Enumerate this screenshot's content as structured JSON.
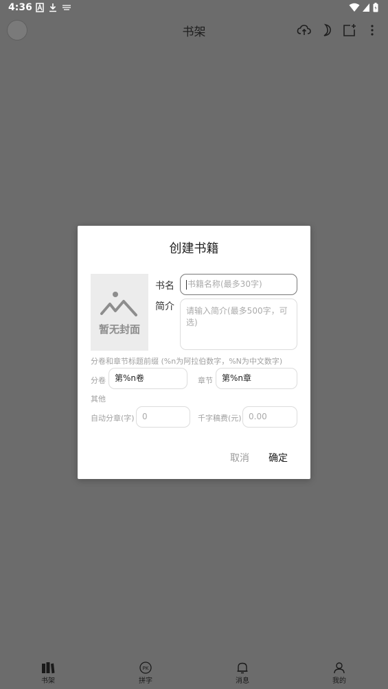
{
  "status_bar": {
    "time": "4:36"
  },
  "app_bar": {
    "title": "书架"
  },
  "dialog": {
    "title": "创建书籍",
    "cover_text": "暂无封面",
    "name_label": "书名",
    "name_placeholder": "书籍名称(最多30字)",
    "intro_label": "简介",
    "intro_placeholder": "请输入简介(最多500字，可选)",
    "prefix_hint": "分卷和章节标题前缀 (%n为阿拉伯数字，%N为中文数字)",
    "volume_label": "分卷",
    "volume_value": "第%n卷",
    "chapter_label": "章节",
    "chapter_value": "第%n章",
    "other_label": "其他",
    "auto_split_label": "自动分章(字)",
    "auto_split_value": "0",
    "fee_label": "千字稿费(元)",
    "fee_value": "0.00",
    "cancel": "取消",
    "confirm": "确定"
  },
  "bottom_nav": [
    {
      "label": "书架",
      "icon": "bookshelf-icon"
    },
    {
      "label": "拼字",
      "icon": "pk-icon"
    },
    {
      "label": "消息",
      "icon": "bell-icon"
    },
    {
      "label": "我的",
      "icon": "person-icon"
    }
  ]
}
